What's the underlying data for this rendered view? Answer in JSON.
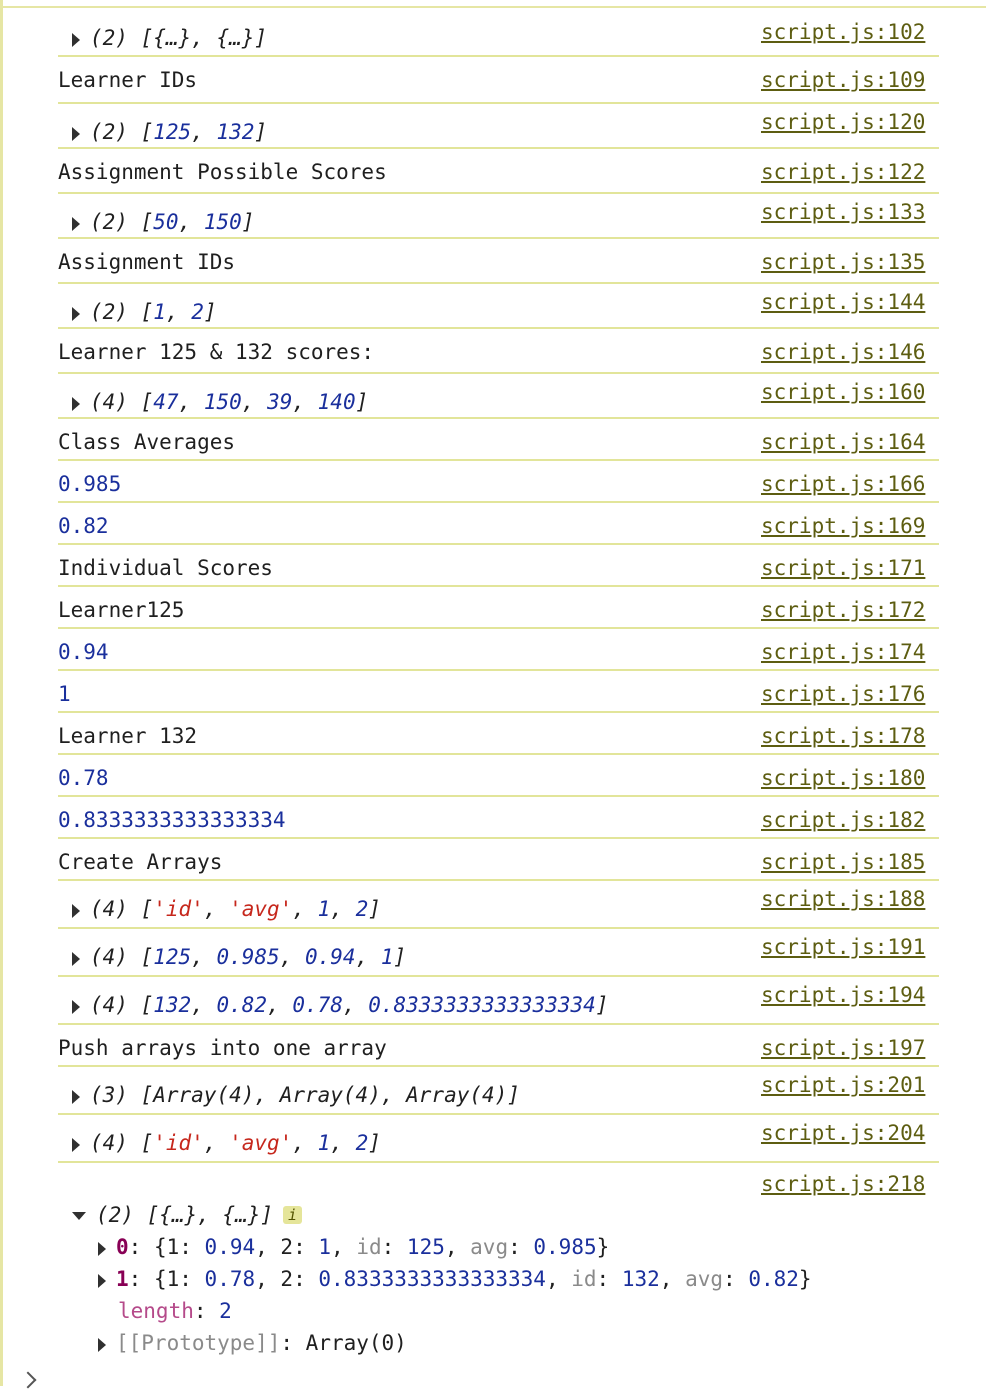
{
  "rows": [
    {
      "kind": "array",
      "count": "(2)",
      "items": [
        {
          "t": "p",
          "v": "{…}"
        },
        {
          "t": "p",
          "v": "{…}"
        }
      ],
      "src": "script.js:102"
    },
    {
      "kind": "text",
      "text": "Learner IDs",
      "src": "script.js:109"
    },
    {
      "kind": "array",
      "count": "(2)",
      "items": [
        {
          "t": "n",
          "v": "125"
        },
        {
          "t": "n",
          "v": "132"
        }
      ],
      "src": "script.js:120"
    },
    {
      "kind": "text",
      "text": "Assignment Possible Scores",
      "src": "script.js:122"
    },
    {
      "kind": "array",
      "count": "(2)",
      "items": [
        {
          "t": "n",
          "v": "50"
        },
        {
          "t": "n",
          "v": "150"
        }
      ],
      "src": "script.js:133"
    },
    {
      "kind": "text",
      "text": "Assignment IDs",
      "src": "script.js:135"
    },
    {
      "kind": "array",
      "count": "(2)",
      "items": [
        {
          "t": "n",
          "v": "1"
        },
        {
          "t": "n",
          "v": "2"
        }
      ],
      "src": "script.js:144"
    },
    {
      "kind": "text",
      "text": "Learner 125 & 132 scores:",
      "src": "script.js:146"
    },
    {
      "kind": "array",
      "count": "(4)",
      "items": [
        {
          "t": "n",
          "v": "47"
        },
        {
          "t": "n",
          "v": "150"
        },
        {
          "t": "n",
          "v": "39"
        },
        {
          "t": "n",
          "v": "140"
        }
      ],
      "src": "script.js:160"
    },
    {
      "kind": "text",
      "text": "Class Averages",
      "src": "script.js:164"
    },
    {
      "kind": "number",
      "text": "0.985",
      "src": "script.js:166"
    },
    {
      "kind": "number",
      "text": "0.82",
      "src": "script.js:169"
    },
    {
      "kind": "text",
      "text": "Individual Scores",
      "src": "script.js:171"
    },
    {
      "kind": "text",
      "text": "Learner125",
      "src": "script.js:172"
    },
    {
      "kind": "number",
      "text": "0.94",
      "src": "script.js:174"
    },
    {
      "kind": "number",
      "text": "1",
      "src": "script.js:176"
    },
    {
      "kind": "text",
      "text": "Learner 132",
      "src": "script.js:178"
    },
    {
      "kind": "number",
      "text": "0.78",
      "src": "script.js:180"
    },
    {
      "kind": "number",
      "text": "0.8333333333333334",
      "src": "script.js:182"
    },
    {
      "kind": "text",
      "text": "Create Arrays",
      "src": "script.js:185"
    },
    {
      "kind": "array",
      "count": "(4)",
      "items": [
        {
          "t": "s",
          "v": "'id'"
        },
        {
          "t": "s",
          "v": "'avg'"
        },
        {
          "t": "n",
          "v": "1"
        },
        {
          "t": "n",
          "v": "2"
        }
      ],
      "src": "script.js:188"
    },
    {
      "kind": "array",
      "count": "(4)",
      "items": [
        {
          "t": "n",
          "v": "125"
        },
        {
          "t": "n",
          "v": "0.985"
        },
        {
          "t": "n",
          "v": "0.94"
        },
        {
          "t": "n",
          "v": "1"
        }
      ],
      "src": "script.js:191"
    },
    {
      "kind": "array",
      "count": "(4)",
      "items": [
        {
          "t": "n",
          "v": "132"
        },
        {
          "t": "n",
          "v": "0.82"
        },
        {
          "t": "n",
          "v": "0.78"
        },
        {
          "t": "n",
          "v": "0.8333333333333334"
        }
      ],
      "src": "script.js:194"
    },
    {
      "kind": "text",
      "text": "Push arrays into one array",
      "src": "script.js:197"
    },
    {
      "kind": "array",
      "count": "(3)",
      "items": [
        {
          "t": "p",
          "v": "Array(4)"
        },
        {
          "t": "p",
          "v": "Array(4)"
        },
        {
          "t": "p",
          "v": "Array(4)"
        }
      ],
      "src": "script.js:201"
    },
    {
      "kind": "array",
      "count": "(4)",
      "items": [
        {
          "t": "s",
          "v": "'id'"
        },
        {
          "t": "s",
          "v": "'avg'"
        },
        {
          "t": "n",
          "v": "1"
        },
        {
          "t": "n",
          "v": "2"
        }
      ],
      "src": "script.js:204"
    }
  ],
  "expanded": {
    "src": "script.js:218",
    "count": "(2)",
    "summary": "[{…}, {…}]",
    "info_badge": "i",
    "items": [
      {
        "index": "0",
        "props": [
          {
            "k": "1",
            "v": "0.94",
            "kt": "n"
          },
          {
            "k": "2",
            "v": "1",
            "kt": "n"
          },
          {
            "k": "id",
            "v": "125",
            "kt": "g"
          },
          {
            "k": "avg",
            "v": "0.985",
            "kt": "g"
          }
        ]
      },
      {
        "index": "1",
        "props": [
          {
            "k": "1",
            "v": "0.78",
            "kt": "n"
          },
          {
            "k": "2",
            "v": "0.8333333333333334",
            "kt": "n"
          },
          {
            "k": "id",
            "v": "132",
            "kt": "g"
          },
          {
            "k": "avg",
            "v": "0.82",
            "kt": "g"
          }
        ]
      }
    ],
    "length_key": "length",
    "length_value": "2",
    "prototype_key": "[[Prototype]]",
    "prototype_value": "Array(0)"
  },
  "colors": {
    "number": "#1a2f9c",
    "string": "#c6271c",
    "source_link": "#5d5d11",
    "row_border": "#e2e59a",
    "info_badge_bg": "#e5e59a"
  }
}
